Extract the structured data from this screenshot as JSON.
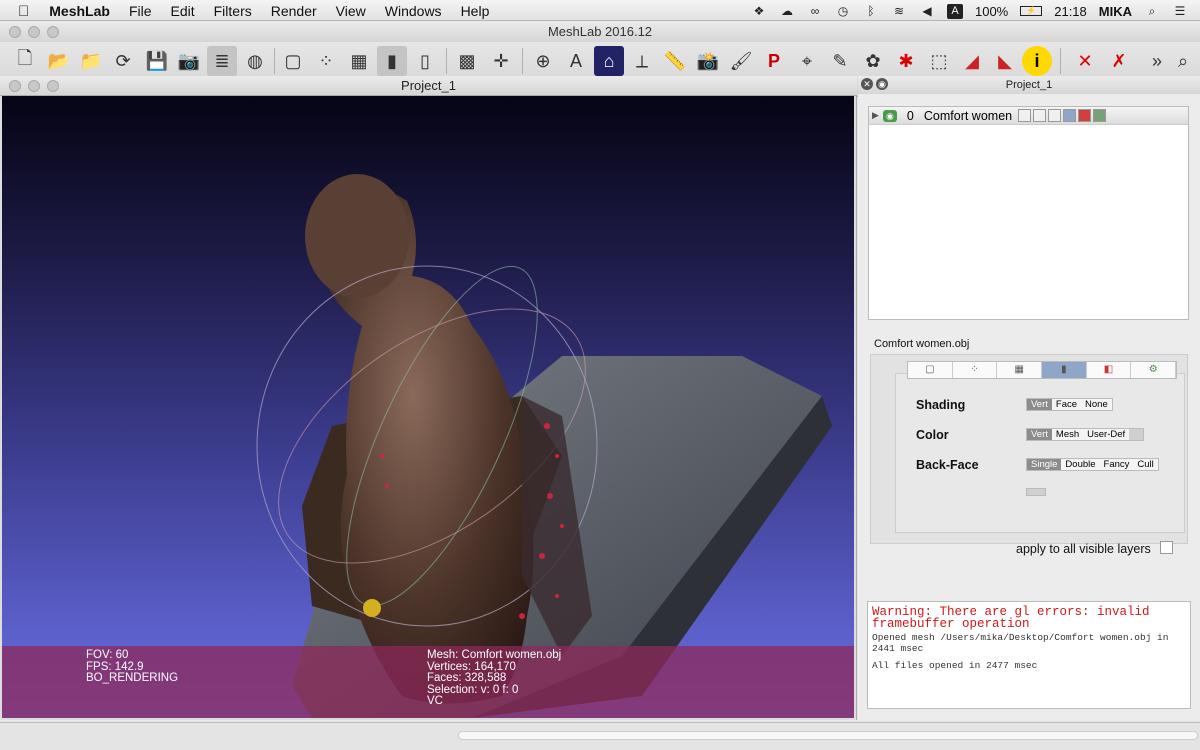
{
  "menubar": {
    "apple_icon": "apple-icon",
    "items": [
      "MeshLab",
      "File",
      "Edit",
      "Filters",
      "Render",
      "View",
      "Windows",
      "Help"
    ],
    "status": {
      "battery": "100%",
      "time": "21:18",
      "user": "MIKA",
      "keyboard": "A"
    }
  },
  "window": {
    "title": "MeshLab 2016.12"
  },
  "toolbar": {
    "buttons": [
      "new-project",
      "import-mesh",
      "open-project",
      "reload",
      "save",
      "snapshot",
      "layers",
      "shading",
      "bbox",
      "points",
      "wireframe",
      "flat",
      "smooth",
      "fancy",
      "axes",
      "trackball",
      "annotation",
      "light",
      "vert-label",
      "edge-label",
      "painting",
      "pick-points",
      "select-faces",
      "georef",
      "measure",
      "info",
      "delete",
      "delete-all"
    ],
    "overflow": "»"
  },
  "subwindow": {
    "title": "Project_1"
  },
  "viewport": {
    "info_left": [
      "FOV: 60",
      "FPS:   142.9",
      "BO_RENDERING"
    ],
    "info_right": [
      "Mesh: Comfort women.obj",
      "Vertices: 164,170",
      "Faces: 328,588",
      "Selection: v: 0 f: 0",
      "VC"
    ]
  },
  "panel": {
    "title": "Project_1",
    "layer": {
      "index": "0",
      "name": "Comfort women"
    },
    "mesh_file": "Comfort women.obj",
    "render": {
      "shading_label": "Shading",
      "shading_options": [
        "Vert",
        "Face",
        "None"
      ],
      "shading_selected": "Vert",
      "color_label": "Color",
      "color_options": [
        "Vert",
        "Mesh",
        "User-Def"
      ],
      "color_selected": "Vert",
      "backface_label": "Back-Face",
      "backface_options": [
        "Single",
        "Double",
        "Fancy",
        "Cull"
      ],
      "backface_selected": "Single"
    },
    "apply_all": "apply to all visible layers",
    "log": {
      "warning": "Warning: There are gl errors: invalid framebuffer operation",
      "lines": [
        "Opened mesh /Users/mika/Desktop/Comfort women.obj in 2441 msec",
        "All files opened in 2477 msec"
      ]
    }
  },
  "colors": {
    "viewport_top": "#050414",
    "viewport_bottom": "#6a70dc",
    "info_overlay": "#8c285a",
    "warning": "#d01818"
  }
}
